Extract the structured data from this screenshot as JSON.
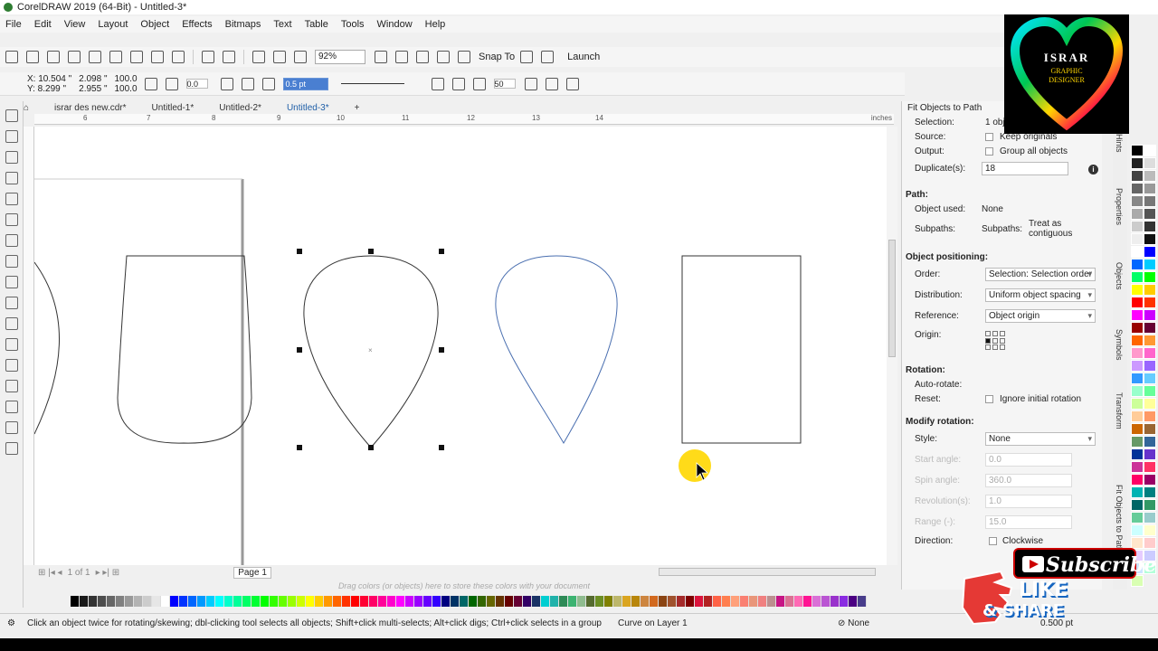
{
  "window": {
    "title": "CorelDRAW 2019 (64-Bit) - Untitled-3*"
  },
  "menu": [
    "File",
    "Edit",
    "View",
    "Layout",
    "Object",
    "Effects",
    "Bitmaps",
    "Text",
    "Table",
    "Tools",
    "Window",
    "Help"
  ],
  "toolbar": {
    "zoom": "92%",
    "snap_label": "Snap To",
    "launch_label": "Launch"
  },
  "propbar": {
    "x": "X: 10.504 \"",
    "y": "Y: 8.299 \"",
    "w": "2.098 \"",
    "h": "2.955 \"",
    "sx": "100.0",
    "sy": "100.0",
    "pct": "%",
    "angle": "0.0",
    "outline": "0.5 pt",
    "steps": "50"
  },
  "doc_tabs": [
    "israr des new.cdr*",
    "Untitled-1*",
    "Untitled-2*",
    "Untitled-3*"
  ],
  "ruler": {
    "unit": "inches",
    "ticks": [
      "6",
      "7",
      "8",
      "9",
      "10",
      "11",
      "12",
      "13",
      "14"
    ]
  },
  "page": {
    "label": "Page 1",
    "nav": "1 of 1"
  },
  "doc_palette_hint": "Drag colors (or objects) here to store these colors with your document",
  "status": {
    "hint": "Click an object twice for rotating/skewing; dbl-clicking tool selects all objects; Shift+click multi-selects; Alt+click digs; Ctrl+click selects in a group",
    "layer": "Curve on Layer 1",
    "fill": "None",
    "outline": "0.500 pt"
  },
  "docker": {
    "title": "Fit Objects to Path",
    "selection_label": "Selection:",
    "selection_value": "1 obje",
    "source_label": "Source:",
    "keep_originals": "Keep originals",
    "output_label": "Output:",
    "group_all": "Group all objects",
    "duplicates_label": "Duplicate(s):",
    "duplicates_value": "18",
    "path_head": "Path:",
    "object_used_label": "Object used:",
    "object_used_value": "None",
    "subpaths_label": "Subpaths:",
    "subpaths_value_label": "Subpaths:",
    "subpaths_value": "Treat as contiguous",
    "positioning_head": "Object positioning:",
    "order_label": "Order:",
    "order_value": "Selection: Selection order",
    "distribution_label": "Distribution:",
    "distribution_value": "Uniform object spacing",
    "reference_label": "Reference:",
    "reference_value": "Object origin",
    "origin_label": "Origin:",
    "rotation_head": "Rotation:",
    "autorotate_label": "Auto-rotate:",
    "reset_label": "Reset:",
    "ignore_rotation": "Ignore initial rotation",
    "modify_head": "Modify rotation:",
    "style_label": "Style:",
    "style_value": "None",
    "start_angle_label": "Start angle:",
    "start_angle_value": "0.0",
    "spin_angle_label": "Spin angle:",
    "spin_angle_value": "360.0",
    "revolutions_label": "Revolution(s):",
    "revolutions_value": "1.0",
    "range_label": "Range (-):",
    "range_value": "15.0",
    "direction_label": "Direction:",
    "clockwise": "Clockwise"
  },
  "docker_tabs": [
    "Hints",
    "Properties",
    "Objects",
    "Symbols",
    "Transform",
    "Fit Objects to Path"
  ],
  "overlay": {
    "logo_line1": "ISRAR",
    "logo_line2": "GRAPHIC",
    "logo_line3": "DESIGNER",
    "subscribe": "Subscribe",
    "like": "LIKE",
    "share": "& SHARE"
  },
  "colors": {
    "accent": "#1f5fa8",
    "selection_blue": "#4a7fd1",
    "cursor_halo": "#ffd700"
  }
}
